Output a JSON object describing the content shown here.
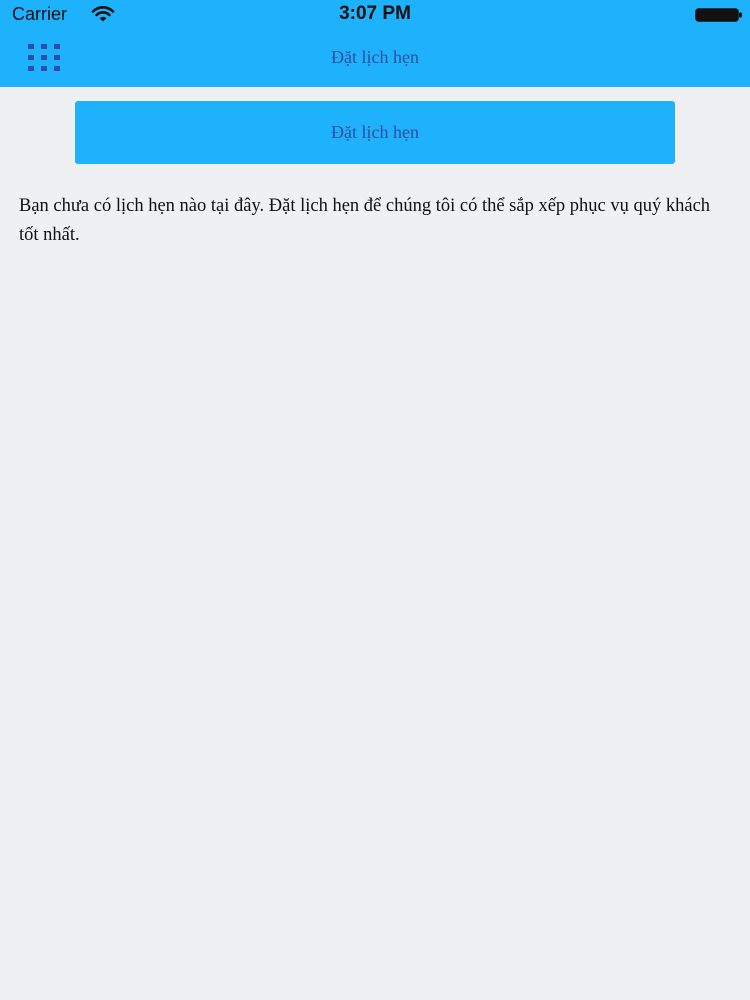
{
  "status_bar": {
    "carrier": "Carrier",
    "time": "3:07 PM",
    "icons": [
      "wifi-icon",
      "battery-icon"
    ]
  },
  "nav": {
    "title": "Đặt lịch hẹn",
    "menu_icon": "grid-menu-icon"
  },
  "main": {
    "book_button_label": "Đặt lịch hẹn",
    "empty_message": "Bạn chưa có lịch hẹn nào tại đây. Đặt lịch hẹn để chúng tôi có thể sắp xếp phục vụ quý khách tốt nhất."
  },
  "colors": {
    "accent": "#1eb1fc",
    "accent_text": "#2d4ea5",
    "background": "#eff0f2",
    "text": "#111111"
  }
}
